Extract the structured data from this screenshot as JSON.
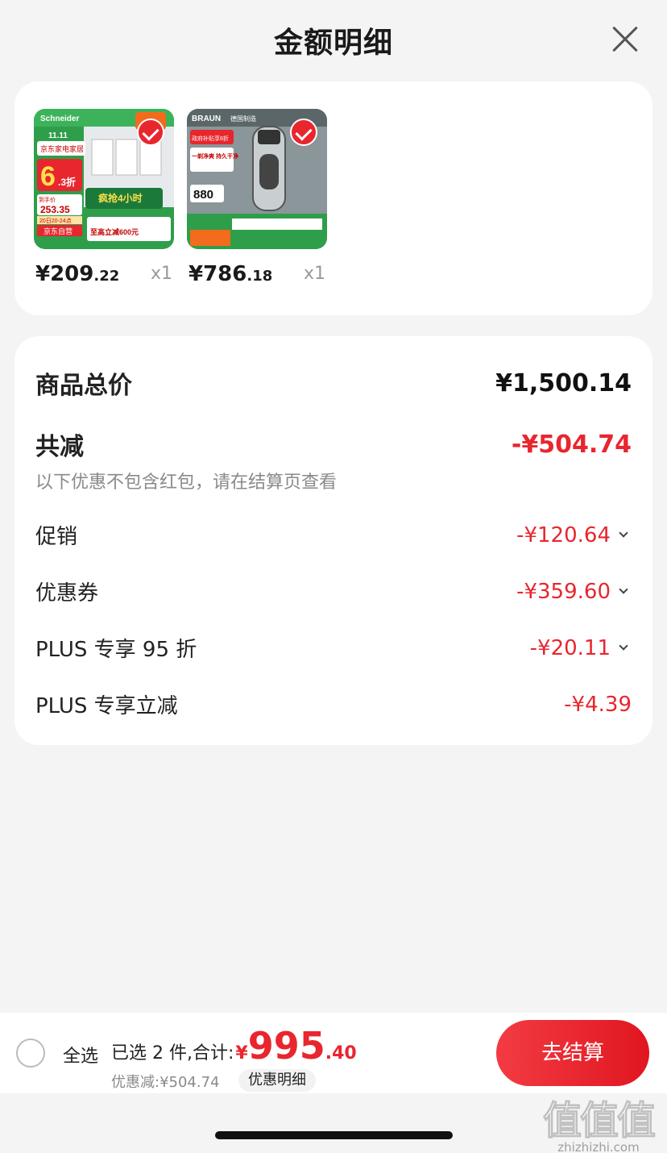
{
  "header": {
    "title": "金额明细"
  },
  "products": [
    {
      "price_int": "¥209",
      "price_dec": ".22",
      "qty": "x1",
      "image": {
        "brand": "Schneider",
        "tag": "11.11",
        "store": "京东家电家居",
        "discount_int": "6",
        "discount_dec": ".3折",
        "promo": "疯抢4小时",
        "promo_sub": "到手价",
        "deal_price": "253.35",
        "date": "20日20-24点",
        "self_op": "京东自营",
        "subsidy": "至高立减600元"
      }
    },
    {
      "price_int": "¥786",
      "price_dec": ".18",
      "qty": "x1",
      "image": {
        "brand": "BRAUN",
        "tag": "德国制造",
        "subsidy": "政府补贴享8折",
        "headline": "一剃净爽 持久干净",
        "deal_price": "880"
      }
    }
  ],
  "summary": {
    "total_label": "商品总价",
    "total_value": "¥1,500.14",
    "reduce_label": "共减",
    "reduce_value": "-¥504.74",
    "note": "以下优惠不包含红包，请在结算页查看",
    "items": [
      {
        "label": "促销",
        "value": "-¥120.64",
        "expandable": true
      },
      {
        "label": "优惠券",
        "value": "-¥359.60",
        "expandable": true
      },
      {
        "label": "PLUS 专享 95 折",
        "value": "-¥20.11",
        "expandable": true
      },
      {
        "label": "PLUS 专享立减",
        "value": "-¥4.39",
        "expandable": false
      }
    ]
  },
  "bottom": {
    "select_all": "全选",
    "total_label": "已选 2 件,合计:",
    "total_yen": "¥",
    "total_int": "995",
    "total_dec": ".40",
    "discount": "优惠减:¥504.74",
    "detail_button": "优惠明细",
    "checkout_button": "去结算"
  },
  "watermark": {
    "mark": "值值值",
    "text": "zhizhizhi.com"
  },
  "colors": {
    "accent": "#e8262e",
    "background": "#f4f4f4",
    "card": "#ffffff"
  }
}
